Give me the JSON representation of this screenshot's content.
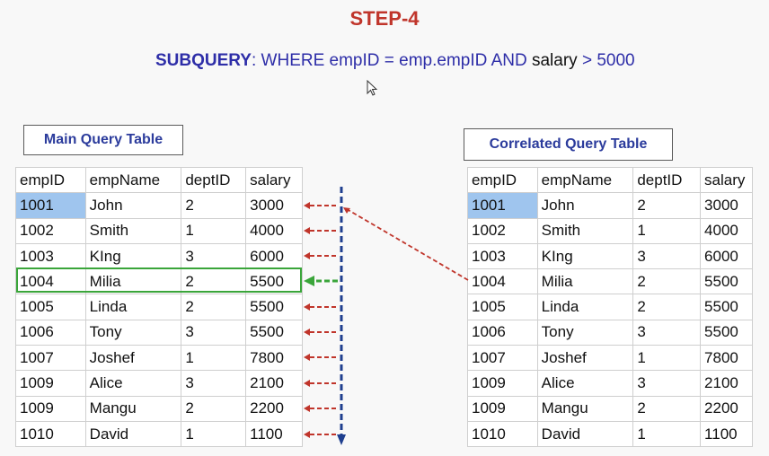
{
  "title": "STEP-4",
  "subquery": {
    "keyword": "SUBQUERY",
    "part1": ":  WHERE empID = emp.empID  AND ",
    "part2": "salary",
    "part3": " > 5000"
  },
  "main_table": {
    "label": "Main Query Table",
    "headers": [
      "empID",
      "empName",
      "deptID",
      "salary"
    ],
    "rows": [
      [
        "1001",
        "John",
        "2",
        "3000"
      ],
      [
        "1002",
        "Smith",
        "1",
        "4000"
      ],
      [
        "1003",
        "KIng",
        "3",
        "6000"
      ],
      [
        "1004",
        "Milia",
        "2",
        "5500"
      ],
      [
        "1005",
        "Linda",
        "2",
        "5500"
      ],
      [
        "1006",
        "Tony",
        "3",
        "5500"
      ],
      [
        "1007",
        "Joshef",
        "1",
        "7800"
      ],
      [
        "1009",
        "Alice",
        "3",
        "2100"
      ],
      [
        "1009",
        "Mangu",
        "2",
        "2200"
      ],
      [
        "1010",
        "David",
        "1",
        "1100"
      ]
    ]
  },
  "correlated_table": {
    "label": "Correlated Query Table",
    "headers": [
      "empID",
      "empName",
      "deptID",
      "salary"
    ],
    "rows": [
      [
        "1001",
        "John",
        "2",
        "3000"
      ],
      [
        "1002",
        "Smith",
        "1",
        "4000"
      ],
      [
        "1003",
        "KIng",
        "3",
        "6000"
      ],
      [
        "1004",
        "Milia",
        "2",
        "5500"
      ],
      [
        "1005",
        "Linda",
        "2",
        "5500"
      ],
      [
        "1006",
        "Tony",
        "3",
        "5500"
      ],
      [
        "1007",
        "Joshef",
        "1",
        "7800"
      ],
      [
        "1009",
        "Alice",
        "3",
        "2100"
      ],
      [
        "1009",
        "Mangu",
        "2",
        "2200"
      ],
      [
        "1010",
        "David",
        "1",
        "1100"
      ]
    ]
  },
  "colors": {
    "title": "#c0352b",
    "query_text": "#2e2ea8",
    "label_text": "#2b3b9c",
    "selected_cell": "#9fc5ee",
    "red_arrow": "#c0352b",
    "green_arrow": "#3aa53a",
    "blue_arrow": "#1f3f8f"
  },
  "state": {
    "highlighted_main_row": 3,
    "selected_main_cell": "empID of row 1001",
    "selected_corr_cell": "empID of row 1001"
  }
}
